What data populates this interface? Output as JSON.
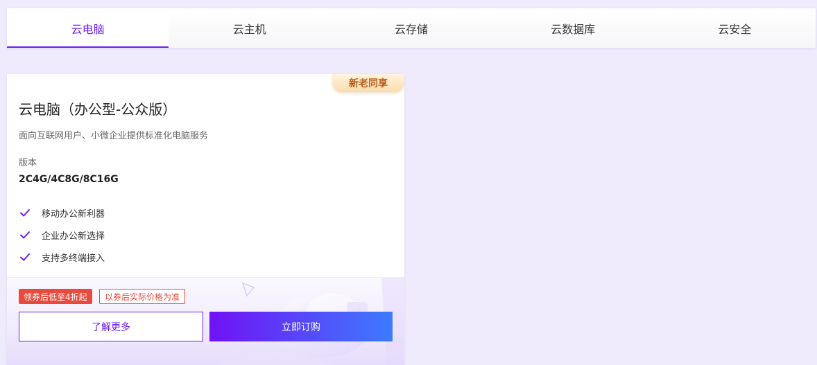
{
  "tabs": [
    {
      "label": "云电脑",
      "active": true
    },
    {
      "label": "云主机",
      "active": false
    },
    {
      "label": "云存储",
      "active": false
    },
    {
      "label": "云数据库",
      "active": false
    },
    {
      "label": "云安全",
      "active": false
    }
  ],
  "product": {
    "badge": "新老同享",
    "title": "云电脑（办公型-公众版）",
    "description": "面向互联网用户、小微企业提供标准化电脑服务",
    "version_label": "版本",
    "version_value": "2C4G/4C8G/8C16G",
    "features": [
      {
        "label": "移动办公新利器",
        "icon": "check-icon"
      },
      {
        "label": "企业办公新选择",
        "icon": "check-icon"
      },
      {
        "label": "支持多终端接入",
        "icon": "check-icon"
      }
    ],
    "coupon_tag": "领券后低至4折起",
    "coupon_note": "以券后实际价格为准",
    "learn_more_label": "了解更多",
    "buy_label": "立即订购"
  },
  "colors": {
    "accent": "#6a1df0",
    "page_background": "#efebfd",
    "coupon_red": "#e94a3d",
    "badge_text": "#b85d1a",
    "buy_gradient_start": "#7012f5",
    "buy_gradient_end": "#3d7bff"
  }
}
